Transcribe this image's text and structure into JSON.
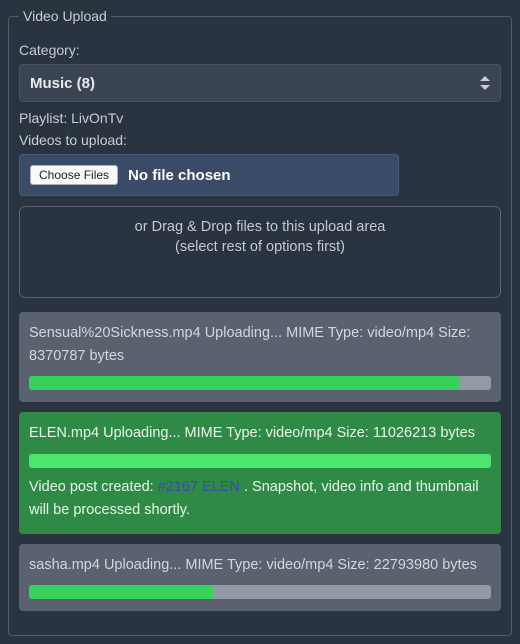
{
  "legend": "Video Upload",
  "category_label": "Category:",
  "category_value": "Music  (8)",
  "playlist_label": "Playlist: LivOnTv",
  "videos_label": "Videos to upload:",
  "choose_files_btn": "Choose Files",
  "no_file_chosen": "No file chosen",
  "dropzone_line1": "or Drag & Drop files to this upload area",
  "dropzone_line2": "(select rest of options first)",
  "uploads": [
    {
      "text": "Sensual%20Sickness.mp4 Uploading... MIME Type: video/mp4 Size: 8370787 bytes",
      "progress": 93,
      "variant": "gray"
    },
    {
      "text": "ELEN.mp4 Uploading... MIME Type: video/mp4 Size: 11026213 bytes",
      "progress": 100,
      "variant": "green",
      "post_prefix": "Video post created: ",
      "post_link_text": "#2167 ELEN",
      "post_suffix": " . Snapshot, video info and thumbnail will be processed shortly."
    },
    {
      "text": "sasha.mp4 Uploading... MIME Type: video/mp4 Size: 22793980 bytes",
      "progress": 40,
      "variant": "gray"
    }
  ]
}
